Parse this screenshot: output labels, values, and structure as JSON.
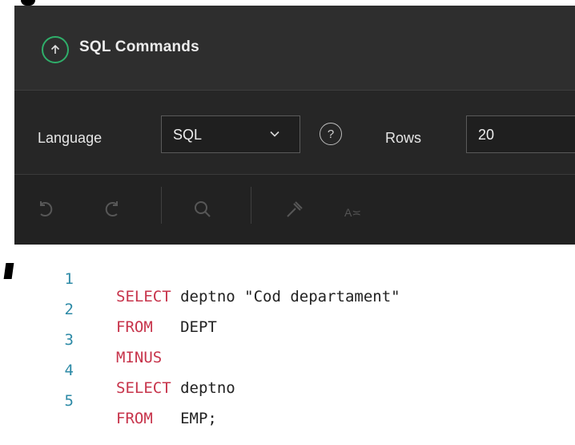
{
  "panel": {
    "title": "SQL Commands"
  },
  "toolbar": {
    "language_label": "Language",
    "language_value": "SQL",
    "rows_label": "Rows",
    "rows_value": "20",
    "help_glyph": "?",
    "case_glyph": "A≍"
  },
  "icons": {
    "title": "up-arrow-icon",
    "undo": "undo-icon",
    "redo": "redo-icon",
    "find": "search-icon",
    "format": "hammer-icon",
    "case": "text-case-icon"
  },
  "colors": {
    "accent_green": "#2fae6a",
    "keyword": "#c7344b",
    "line_number": "#2d8aa6"
  },
  "editor": {
    "lines": [
      {
        "num": "1",
        "kw": "SELECT",
        "rest": " deptno \"Cod departament\""
      },
      {
        "num": "2",
        "kw": "FROM",
        "rest": "   DEPT"
      },
      {
        "num": "3",
        "kw": "MINUS",
        "rest": ""
      },
      {
        "num": "4",
        "kw": "SELECT",
        "rest": " deptno"
      },
      {
        "num": "5",
        "kw": "FROM",
        "rest": "   EMP;"
      }
    ]
  }
}
